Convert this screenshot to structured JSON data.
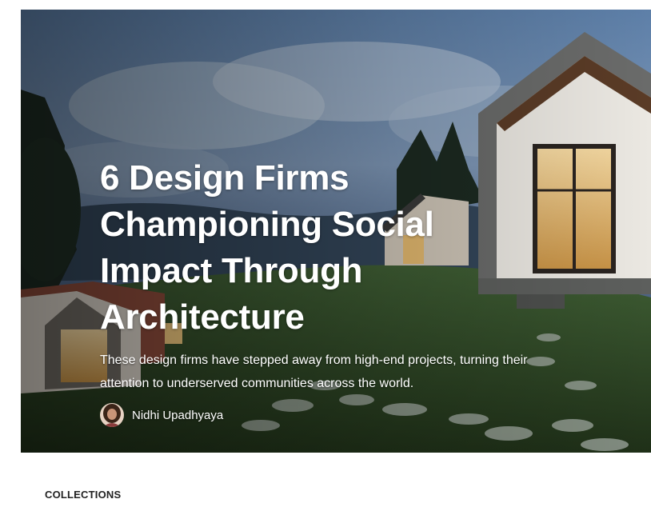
{
  "hero": {
    "title_lines": [
      "6 Design Firms",
      "Championing Social",
      "Impact Through",
      "Architecture"
    ],
    "subtitle": "These design firms have stepped away from high-end projects, turning their attention to underserved communities across the world.",
    "author": {
      "name": "Nidhi Upadhyaya"
    }
  },
  "section": {
    "label": "COLLECTIONS"
  },
  "colors": {
    "title_text": "#ffffff",
    "section_label": "#222222",
    "background": "#ffffff"
  }
}
